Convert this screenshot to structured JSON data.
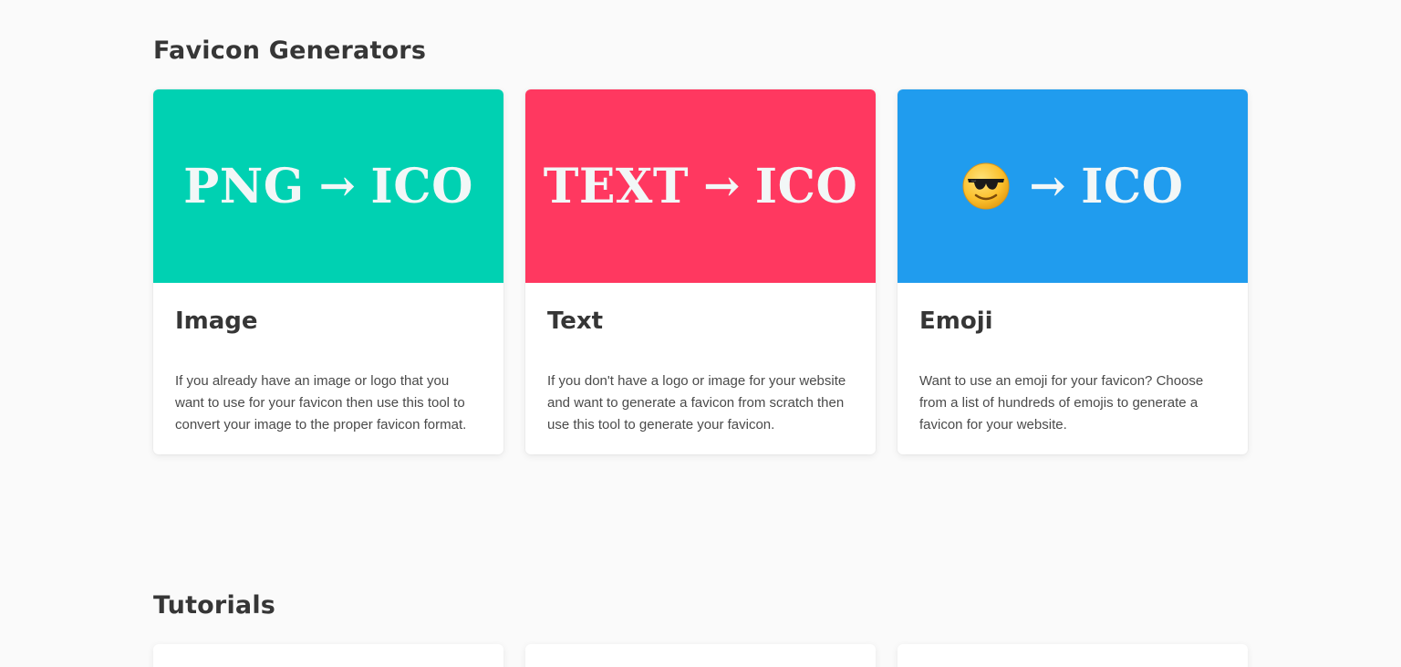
{
  "generators": {
    "title": "Favicon Generators",
    "cards": [
      {
        "banner_left": "PNG",
        "banner_arrow": "→",
        "banner_right": "ICO",
        "banner_color": "#00d1b2",
        "title": "Image",
        "description": "If you already have an image or logo that you want to use for your favicon then use this tool to convert your image to the proper favicon format."
      },
      {
        "banner_left": "TEXT",
        "banner_arrow": "→",
        "banner_right": "ICO",
        "banner_color": "#ff3860",
        "title": "Text",
        "description": "If you don't have a logo or image for your website and want to generate a favicon from scratch then use this tool to generate your favicon."
      },
      {
        "banner_left_icon": "smiling-face-with-sunglasses-emoji",
        "banner_arrow": "→",
        "banner_right": "ICO",
        "banner_color": "#209cee",
        "title": "Emoji",
        "description": "Want to use an emoji for your favicon? Choose from a list of hundreds of emojis to generate a favicon for your website."
      }
    ]
  },
  "tutorials": {
    "title": "Tutorials"
  }
}
